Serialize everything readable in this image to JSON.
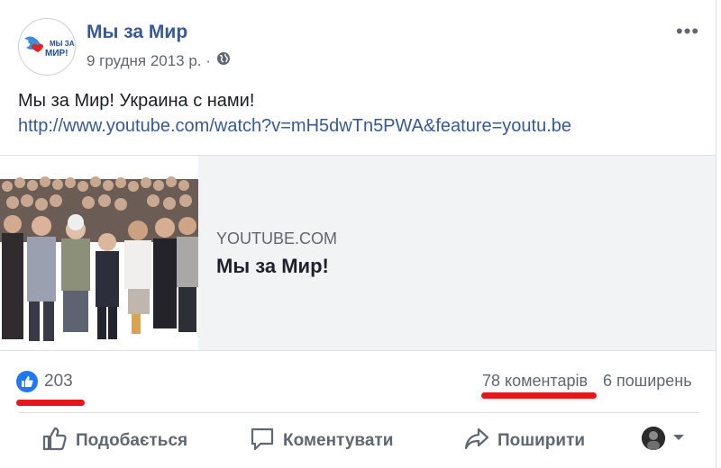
{
  "post": {
    "page_name": "Мы за Мир",
    "date": "9 грудня 2013 р. ·",
    "avatar_text_top": "МЫ ЗА",
    "avatar_text_bottom": "МИР!",
    "text_line": "Мы за Мир! Украина с нами!",
    "link": "http://www.youtube.com/watch?v=mH5dwTn5PWA&feature=youtu.be",
    "more_label": "•••"
  },
  "preview": {
    "domain": "YOUTUBE.COM",
    "title": "Мы за Мир!"
  },
  "stats": {
    "likes": "203",
    "comments": "78 коментарів",
    "shares": "6 поширень"
  },
  "actions": {
    "like": "Подобається",
    "comment": "Коментувати",
    "share": "Поширити"
  },
  "colors": {
    "link": "#385898",
    "like_blue": "#2078f4",
    "underline_red": "#e8151b"
  },
  "icons": [
    "globe-icon",
    "thumbs-up-icon",
    "comment-icon",
    "share-icon",
    "chevron-down-icon",
    "more-icon"
  ]
}
